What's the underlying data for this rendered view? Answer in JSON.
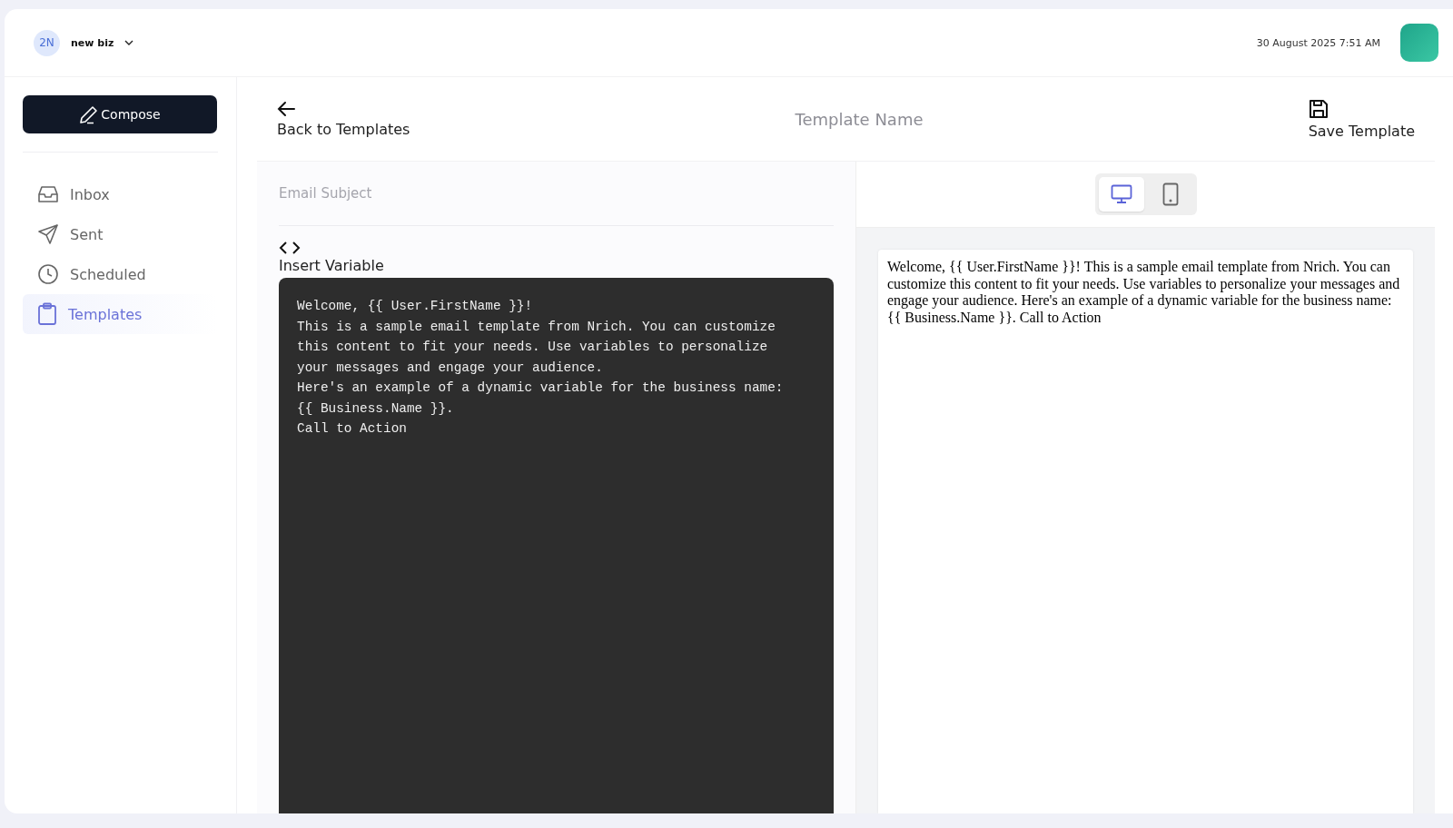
{
  "account": {
    "initials": "2N",
    "name": "new biz"
  },
  "datetime": "30 August 2025 7:51 AM",
  "sidebar": {
    "compose": "Compose",
    "items": [
      {
        "label": "Inbox",
        "kind": "inbox",
        "selected": false
      },
      {
        "label": "Sent",
        "kind": "sent",
        "selected": false
      },
      {
        "label": "Scheduled",
        "kind": "scheduled",
        "selected": false
      },
      {
        "label": "Templates",
        "kind": "templates",
        "selected": true
      }
    ]
  },
  "toolbar": {
    "back": "Back to Templates",
    "template_name_placeholder": "Template Name",
    "save": "Save Template"
  },
  "editor": {
    "subject_placeholder": "Email Subject",
    "insert_variable": "Insert Variable",
    "body_lines": [
      "Welcome, {{ User.FirstName }}!",
      "This is a sample email template from Nrich. You can customize",
      "this content to fit your needs. Use variables to personalize",
      "your messages and engage your audience.",
      "Here's an example of a dynamic variable for the business name:",
      "{{ Business.Name }}.",
      "Call to Action"
    ]
  },
  "preview": {
    "devices": [
      {
        "kind": "desktop",
        "selected": true
      },
      {
        "kind": "mobile",
        "selected": false
      }
    ],
    "text": "Welcome, {{ User.FirstName }}! This is a sample email template from Nrich. You can customize this content to fit your needs. Use variables to personalize your messages and engage your audience. Here's an example of a dynamic variable for the business name: {{ Business.Name }}. Call to Action"
  }
}
